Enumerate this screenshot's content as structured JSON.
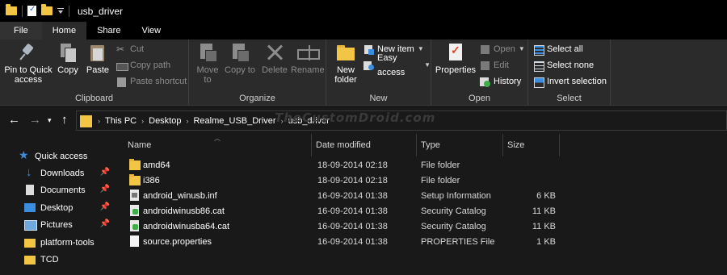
{
  "window": {
    "title": "usb_driver"
  },
  "tabs": [
    {
      "label": "File"
    },
    {
      "label": "Home"
    },
    {
      "label": "Share"
    },
    {
      "label": "View"
    }
  ],
  "ribbon": {
    "clipboard": {
      "label": "Clipboard",
      "pin_to_quick_access": "Pin to Quick access",
      "copy": "Copy",
      "paste": "Paste",
      "cut": "Cut",
      "copy_path": "Copy path",
      "paste_shortcut": "Paste shortcut"
    },
    "organize": {
      "label": "Organize",
      "move_to": "Move to",
      "copy_to": "Copy to",
      "delete": "Delete",
      "rename": "Rename"
    },
    "new": {
      "label": "New",
      "new_folder": "New folder",
      "new_item": "New item",
      "easy_access": "Easy access"
    },
    "open": {
      "label": "Open",
      "properties": "Properties",
      "open": "Open",
      "edit": "Edit",
      "history": "History"
    },
    "select": {
      "label": "Select",
      "select_all": "Select all",
      "select_none": "Select none",
      "invert_selection": "Invert selection"
    }
  },
  "breadcrumb": [
    "This PC",
    "Desktop",
    "Realme_USB_Driver",
    "usb_driver"
  ],
  "watermark": "TheCustomDroid.com",
  "nav_pane": [
    {
      "label": "Quick access",
      "icon": "star-icon"
    },
    {
      "label": "Downloads",
      "icon": "download-icon",
      "pinned": true
    },
    {
      "label": "Documents",
      "icon": "documents-icon",
      "pinned": true
    },
    {
      "label": "Desktop",
      "icon": "desktop-icon",
      "pinned": true
    },
    {
      "label": "Pictures",
      "icon": "pictures-icon",
      "pinned": true
    },
    {
      "label": "platform-tools",
      "icon": "folder-icon"
    },
    {
      "label": "TCD",
      "icon": "folder-icon"
    }
  ],
  "columns": [
    "Name",
    "Date modified",
    "Type",
    "Size"
  ],
  "files": [
    {
      "name": "amd64",
      "date": "18-09-2014 02:18",
      "type": "File folder",
      "size": "",
      "icon": "folder-icon"
    },
    {
      "name": "i386",
      "date": "18-09-2014 02:18",
      "type": "File folder",
      "size": "",
      "icon": "folder-icon"
    },
    {
      "name": "android_winusb.inf",
      "date": "16-09-2014 01:38",
      "type": "Setup Information",
      "size": "6 KB",
      "icon": "setup-info-icon"
    },
    {
      "name": "androidwinusb86.cat",
      "date": "16-09-2014 01:38",
      "type": "Security Catalog",
      "size": "11 KB",
      "icon": "security-catalog-icon"
    },
    {
      "name": "androidwinusba64.cat",
      "date": "16-09-2014 01:38",
      "type": "Security Catalog",
      "size": "11 KB",
      "icon": "security-catalog-icon"
    },
    {
      "name": "source.properties",
      "date": "16-09-2014 01:38",
      "type": "PROPERTIES File",
      "size": "1 KB",
      "icon": "document-icon"
    }
  ]
}
